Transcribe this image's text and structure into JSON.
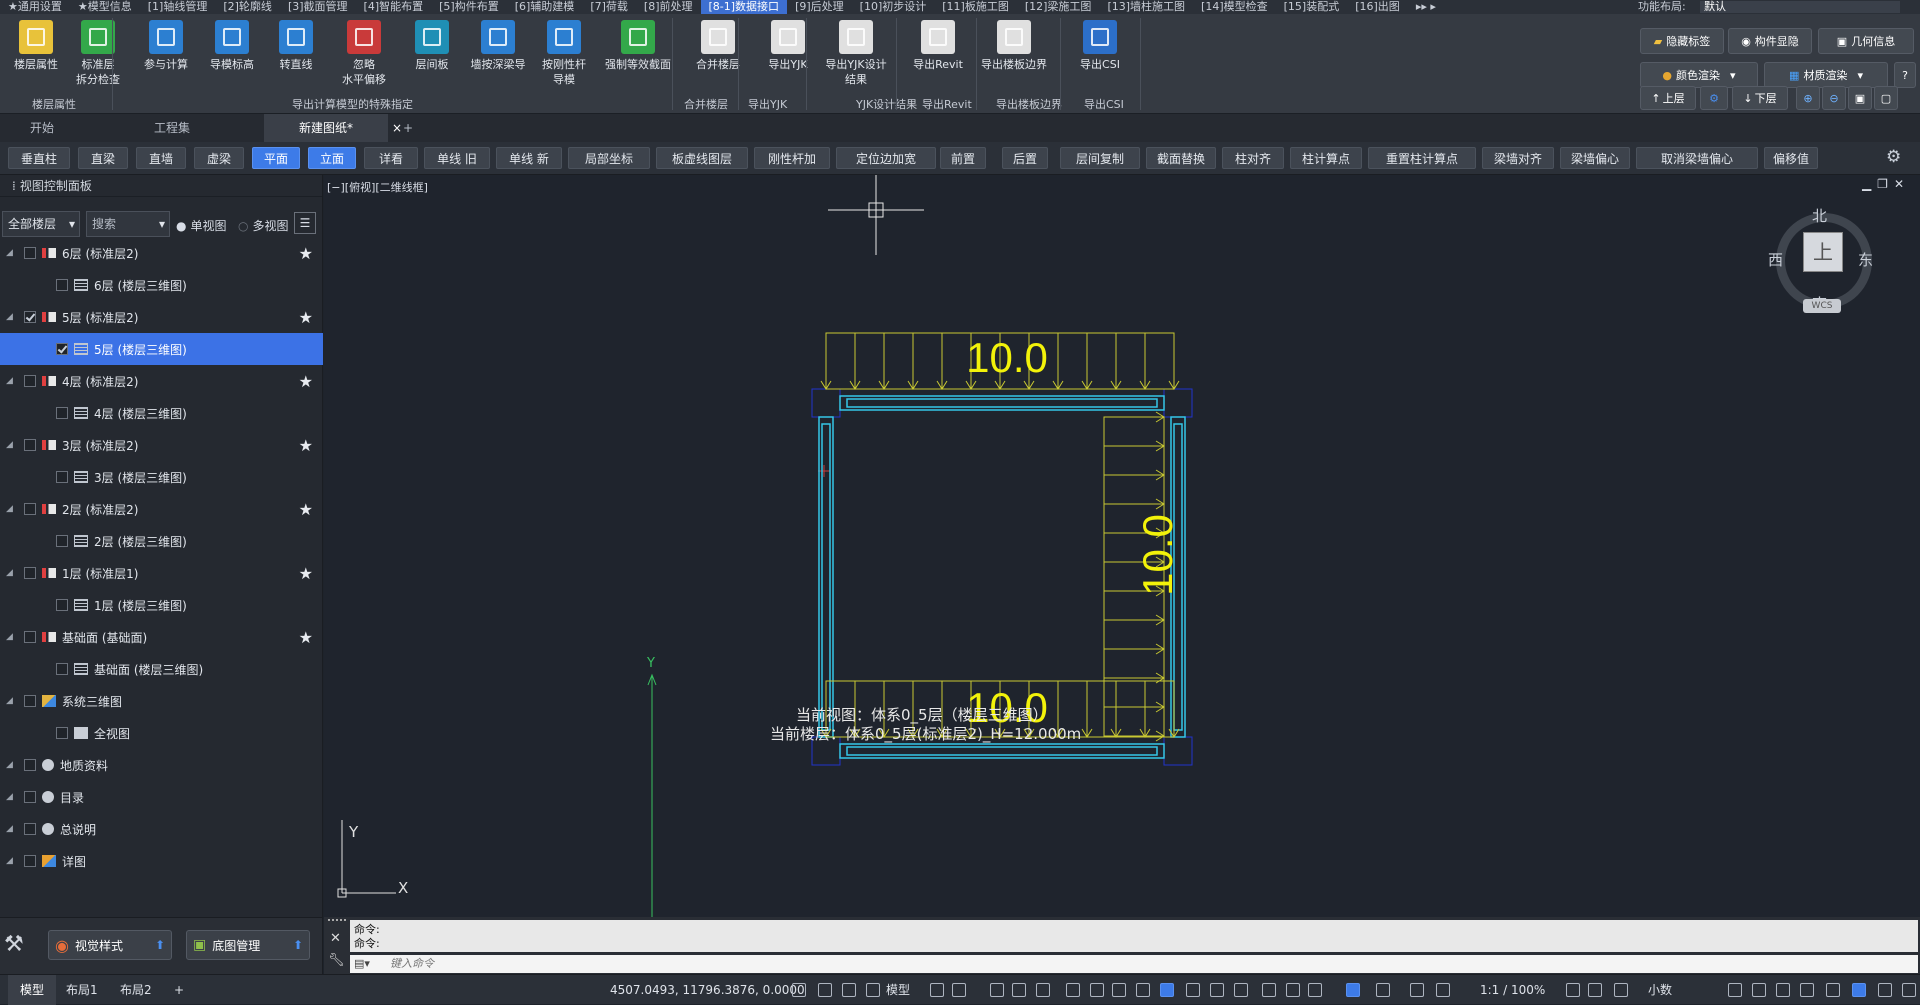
{
  "menubar": {
    "items": [
      "★通用设置",
      "★模型信息",
      "[1]轴线管理",
      "[2]轮廓线",
      "[3]截面管理",
      "[4]智能布置",
      "[5]构件布置",
      "[6]辅助建模",
      "[7]荷载",
      "[8]前处理",
      "[8-1]数据接口",
      "[9]后处理",
      "[10]初步设计",
      "[11]板施工图",
      "[12]梁施工图",
      "[13]墙柱施工图",
      "[14]模型检查",
      "[15]装配式",
      "[16]出图"
    ],
    "active_index": 10,
    "more": "▸▸ ▸",
    "layout_label": "功能布局:",
    "layout_value": "默认"
  },
  "ribbon": {
    "buttons": [
      {
        "label": "楼层属性",
        "color": "#e8c23a"
      },
      {
        "label": "标准层\n拆分检查",
        "color": "#33a84a"
      },
      {
        "label": "参与计算",
        "color": "#2c7fd1"
      },
      {
        "label": "导模标高",
        "color": "#2c7fd1"
      },
      {
        "label": "转直线",
        "color": "#2c7fd1"
      },
      {
        "label": "忽略\n水平偏移",
        "color": "#c93a3a"
      },
      {
        "label": "层间板",
        "color": "#1f8fb5"
      },
      {
        "label": "墙按深梁导",
        "color": "#2c7fd1"
      },
      {
        "label": "按刚性杆\n导模",
        "color": "#2c7fd1"
      },
      {
        "label": "强制等效截面",
        "color": "#33a84a"
      },
      {
        "label": "合并楼层",
        "color": "#e0e0e0"
      },
      {
        "label": "导出YJK",
        "color": "#e0e0e0"
      },
      {
        "label": "导出YJK设计结果",
        "color": "#e0e0e0"
      },
      {
        "label": "导出Revit",
        "color": "#e0e0e0"
      },
      {
        "label": "导出楼板边界",
        "color": "#e0e0e0"
      },
      {
        "label": "导出CSI",
        "color": "#2c6fc9"
      }
    ],
    "groups": [
      "楼层属性",
      "导出计算模型的特殊指定",
      "合并楼层",
      "导出YJK",
      "YJK设计结果",
      "导出Revit",
      "导出楼板边界",
      "导出CSI"
    ],
    "right_buttons": {
      "hide_labels": "隐藏标签",
      "component_display": "构件显隐",
      "geometry_info": "几何信息",
      "color_render": "颜色渲染",
      "material_render": "材质渲染",
      "up_floor": "上层",
      "down_floor": "下层",
      "help": "?"
    }
  },
  "tabs": {
    "items": [
      "开始",
      "工程集",
      "新建图纸*"
    ],
    "active_index": 2,
    "close": "×",
    "add": "+"
  },
  "toolbar": {
    "items": [
      "垂直柱",
      "直梁",
      "直墙",
      "虚梁",
      "平面",
      "立面",
      "详看",
      "单线 旧",
      "单线 新",
      "局部坐标",
      "板虚线图层",
      "刚性杆加",
      "定位边加宽",
      "前置",
      "后置",
      "层间复制",
      "截面替换",
      "柱对齐",
      "柱计算点",
      "重置柱计算点",
      "梁墙对齐",
      "梁墙偏心",
      "取消梁墙偏心",
      "偏移值"
    ],
    "active": [
      "平面",
      "立面"
    ]
  },
  "panel": {
    "title": "视图控制面板",
    "floor_select": "全部楼层",
    "search_placeholder": "搜索",
    "single_view": "单视图",
    "multi_view": "多视图",
    "tree": [
      {
        "label": "6层 (标准层2)",
        "level": 0,
        "type": "std",
        "checked": false,
        "star": true
      },
      {
        "label": "6层 (楼层三维图)",
        "level": 1,
        "type": "view",
        "checked": false,
        "star": false
      },
      {
        "label": "5层 (标准层2)",
        "level": 0,
        "type": "std",
        "checked": true,
        "star": true
      },
      {
        "label": "5层 (楼层三维图)",
        "level": 1,
        "type": "view",
        "checked": true,
        "star": false,
        "selected": true
      },
      {
        "label": "4层 (标准层2)",
        "level": 0,
        "type": "std",
        "checked": false,
        "star": true
      },
      {
        "label": "4层 (楼层三维图)",
        "level": 1,
        "type": "view",
        "checked": false,
        "star": false
      },
      {
        "label": "3层 (标准层2)",
        "level": 0,
        "type": "std",
        "checked": false,
        "star": true
      },
      {
        "label": "3层 (楼层三维图)",
        "level": 1,
        "type": "view",
        "checked": false,
        "star": false
      },
      {
        "label": "2层 (标准层2)",
        "level": 0,
        "type": "std",
        "checked": false,
        "star": true
      },
      {
        "label": "2层 (楼层三维图)",
        "level": 1,
        "type": "view",
        "checked": false,
        "star": false
      },
      {
        "label": "1层 (标准层1)",
        "level": 0,
        "type": "std",
        "checked": false,
        "star": true
      },
      {
        "label": "1层 (楼层三维图)",
        "level": 1,
        "type": "view",
        "checked": false,
        "star": false
      },
      {
        "label": "基础面 (基础面)",
        "level": 0,
        "type": "std",
        "checked": false,
        "star": true
      },
      {
        "label": "基础面 (楼层三维图)",
        "level": 1,
        "type": "view",
        "checked": false,
        "star": false
      },
      {
        "label": "系统三维图",
        "level": 0,
        "type": "sys",
        "checked": false,
        "star": false
      },
      {
        "label": "全视图",
        "level": 1,
        "type": "full",
        "checked": false,
        "star": false
      },
      {
        "label": "地质资料",
        "level": 0,
        "type": "dot",
        "checked": false,
        "star": false
      },
      {
        "label": "目录",
        "level": 0,
        "type": "dot",
        "checked": false,
        "star": false
      },
      {
        "label": "总说明",
        "level": 0,
        "type": "dot",
        "checked": false,
        "star": false
      },
      {
        "label": "详图",
        "level": 0,
        "type": "detail",
        "checked": false,
        "star": false
      }
    ],
    "bottom": {
      "visual_style": "视觉样式",
      "base_map": "底图管理"
    }
  },
  "canvas": {
    "view_label": "[−][俯视][二维线框]",
    "load_top": "10.0",
    "load_right": "10.0",
    "load_bottom": "10.0",
    "compass": {
      "north": "北",
      "south": "南",
      "east": "东",
      "west": "西",
      "center": "上",
      "wcs": "WCS"
    },
    "axis_x": "X",
    "axis_y": "Y",
    "axis_y_green": "Y",
    "current_view": "当前视图：体系0_5层（楼层三维图）",
    "current_floor": "当前楼层：体系0_5层(标准层2)_H=12.000m",
    "colors": {
      "load": "#c8c832",
      "beam": "#35c6e8",
      "col": "#2233cc",
      "text": "#f2f20a"
    }
  },
  "command": {
    "line1": "命令:",
    "line2": "命令:",
    "placeholder": "键入命令"
  },
  "status": {
    "tabs": [
      "模型",
      "布局1",
      "布局2"
    ],
    "add": "+",
    "coords": "4507.0493, 11796.3876, 0.0000",
    "mode": "模型",
    "scale": "1:1 / 100%",
    "decimal": "小数"
  }
}
